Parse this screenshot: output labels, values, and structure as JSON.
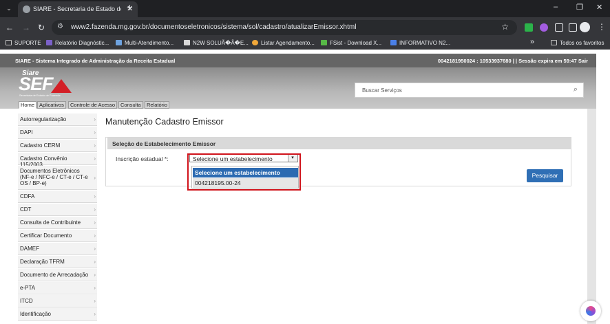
{
  "browser": {
    "tab_title": "SIARE - Secretaria de Estado de",
    "url": "www2.fazenda.mg.gov.br/documentoseletronicos/sistema/sol/cadastro/atualizarEmissor.xhtml",
    "bookmarks": [
      {
        "label": "SUPORTE",
        "icon": "folder-icon",
        "color": "#c8c8c8"
      },
      {
        "label": "Relatório Diagnóstic...",
        "icon": "form-icon",
        "color": "#7b61c9"
      },
      {
        "label": "Multi-Atendimento...",
        "icon": "multi-icon",
        "color": "#6ea3e0"
      },
      {
        "label": "N2W SOLUÃ�Ã�E...",
        "icon": "site-icon",
        "color": "#d9d9d9"
      },
      {
        "label": "Listar Agendamento...",
        "icon": "calendar-icon",
        "color": "#f0a83a"
      },
      {
        "label": "FSist - Download X...",
        "icon": "fsist-icon",
        "color": "#57b947"
      },
      {
        "label": "INFORMATIVO N2...",
        "icon": "doc-icon",
        "color": "#4a80e8"
      }
    ],
    "bookmarks_more": "»",
    "all_favorites": "Todos os favoritos"
  },
  "siare": {
    "system_title": "SIARE - Sistema Integrado de Administração da Receita Estadual",
    "session_info": "0042181950024 : 10533937680 | | Sessão expira em 59:47 Sair",
    "logo": {
      "top": "Siare",
      "main": "SEF",
      "sub": "Secretaria de Estado de Fazenda"
    },
    "search_placeholder": "Buscar Serviços",
    "menu_tabs": [
      "Home",
      "Aplicativos",
      "Controle de Acesso",
      "Consulta",
      "Relatório"
    ],
    "sidebar": [
      "Autorregularização",
      "DAPI",
      "Cadastro CERM",
      "Cadastro Convênio 115/2003",
      "Documentos Eletrônicos (NF-e / NFC-e / CT-e / CT-e OS / BP-e)",
      "CDFA",
      "CDT",
      "Consulta de Contribuinte",
      "Certificar Documento",
      "DAMEF",
      "Declaração TFRM",
      "Documento de Arrecadação",
      "e-PTA",
      "ITCD",
      "Identificação"
    ]
  },
  "main": {
    "title": "Manutenção Cadastro Emissor",
    "panel_title": "Seleção de Estabelecimento Emissor",
    "field_label": "Inscrição estadual *:",
    "select_value": "Selecione um estabelecimento",
    "options": [
      "Selecione um estabelecimento",
      "004218195.00-24"
    ],
    "button": "Pesquisar"
  }
}
